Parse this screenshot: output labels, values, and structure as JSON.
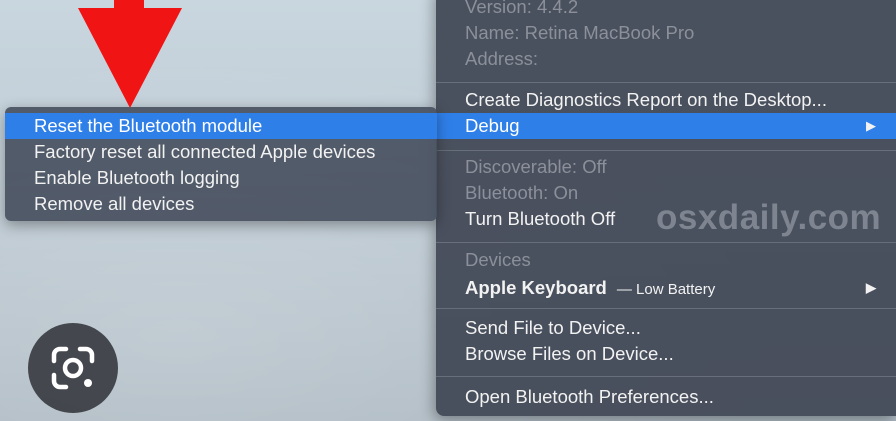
{
  "submenu": {
    "items": [
      {
        "label": "Reset the Bluetooth module",
        "highlighted": true
      },
      {
        "label": "Factory reset all connected Apple devices"
      },
      {
        "label": "Enable Bluetooth logging"
      },
      {
        "label": "Remove all devices"
      }
    ]
  },
  "bluetooth_menu": {
    "version": "Version: 4.4.2",
    "name": "Name: Retina MacBook Pro",
    "address": "Address:",
    "create_report": "Create Diagnostics Report on the Desktop...",
    "debug": "Debug",
    "discoverable": "Discoverable: Off",
    "bluetooth_status": "Bluetooth: On",
    "turn_off": "Turn Bluetooth Off",
    "devices_header": "Devices",
    "device_name": "Apple Keyboard",
    "device_status": "— Low Battery",
    "send_file": "Send File to Device...",
    "browse_files": "Browse Files on Device...",
    "open_prefs": "Open Bluetooth Preferences..."
  },
  "watermark": "osxdaily.com",
  "icons": {
    "submenu_arrow": "chevron-right-icon",
    "lens": "google-lens-icon",
    "annotation": "red-down-arrow"
  },
  "colors": {
    "highlight": "#2f7fe9",
    "annotation_arrow": "#f01414"
  }
}
